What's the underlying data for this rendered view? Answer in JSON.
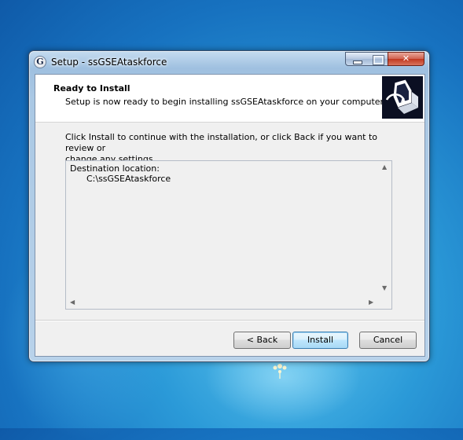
{
  "window": {
    "title": "Setup - ssGSEAtaskforce",
    "icon_letter": "G",
    "controls": [
      "minimize-icon",
      "maximize-icon",
      "close-icon"
    ]
  },
  "header": {
    "title": "Ready to Install",
    "subtitle": "Setup is now ready to begin installing ssGSEAtaskforce on your computer."
  },
  "body": {
    "instructions_line1": "Click Install to continue with the installation, or click Back if you want to review or",
    "instructions_line2": "change any settings.",
    "memo": {
      "line1": "Destination location:",
      "line2": "      C:\\ssGSEAtaskforce"
    }
  },
  "buttons": {
    "back": "< Back",
    "install": "Install",
    "cancel": "Cancel"
  },
  "colors": {
    "desktop": "#1772c0",
    "close_button": "#c1381f",
    "default_button_border": "#3c7fb1"
  }
}
